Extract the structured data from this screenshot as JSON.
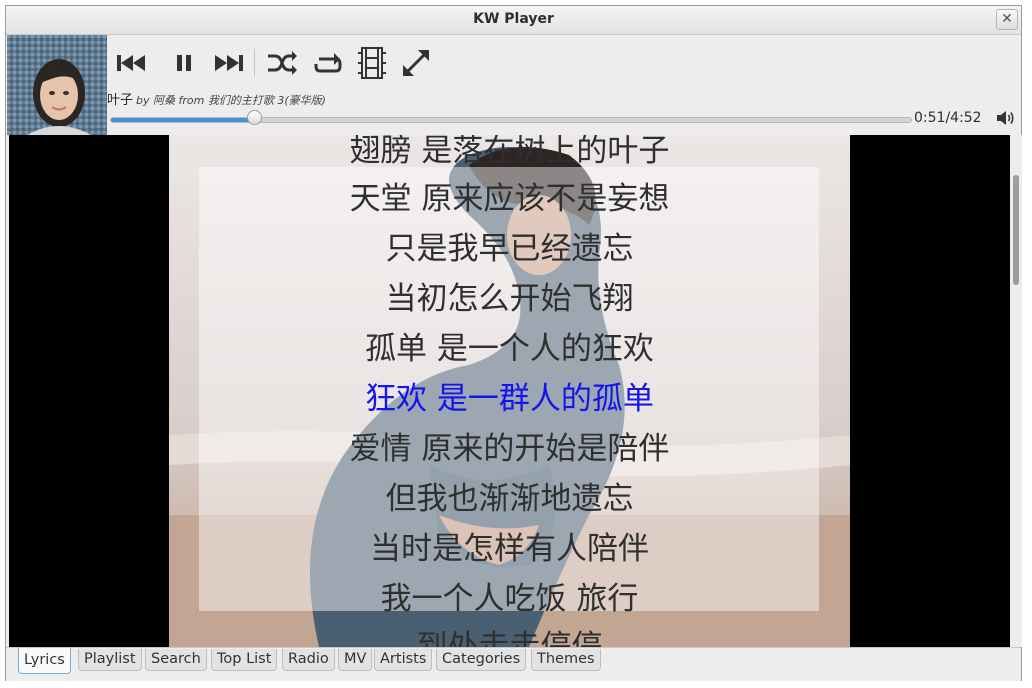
{
  "window": {
    "title": "KW Player",
    "close_glyph": "✕"
  },
  "player": {
    "controls": [
      "prev-icon",
      "pause-icon",
      "next-icon",
      "shuffle-icon",
      "repeat-icon",
      "mv-icon",
      "fullscreen-icon"
    ],
    "song_title": "叶子",
    "meta": "by 阿桑 from 我们的主打歌 3(豪华版)",
    "progress_fraction": 0.18,
    "time": "0:51/4:52",
    "volume_icon": "speaker-icon"
  },
  "lyrics": {
    "lines": [
      "翅膀 是落在树上的叶子",
      "天堂 原来应该不是妄想",
      "只是我早已经遗忘",
      "当初怎么开始飞翔",
      "孤单 是一个人的狂欢",
      "狂欢 是一群人的孤单",
      "爱情 原来的开始是陪伴",
      "但我也渐渐地遗忘",
      "当时是怎样有人陪伴",
      "我一个人吃饭 旅行",
      "到处走走停停"
    ],
    "current_index": 5,
    "highlight_color": "#1414ee"
  },
  "tabs": [
    "Lyrics",
    "Playlist",
    "Search",
    "Top List",
    "Radio",
    "MV",
    "Artists",
    "Categories",
    "Themes"
  ],
  "active_tab": "Lyrics"
}
